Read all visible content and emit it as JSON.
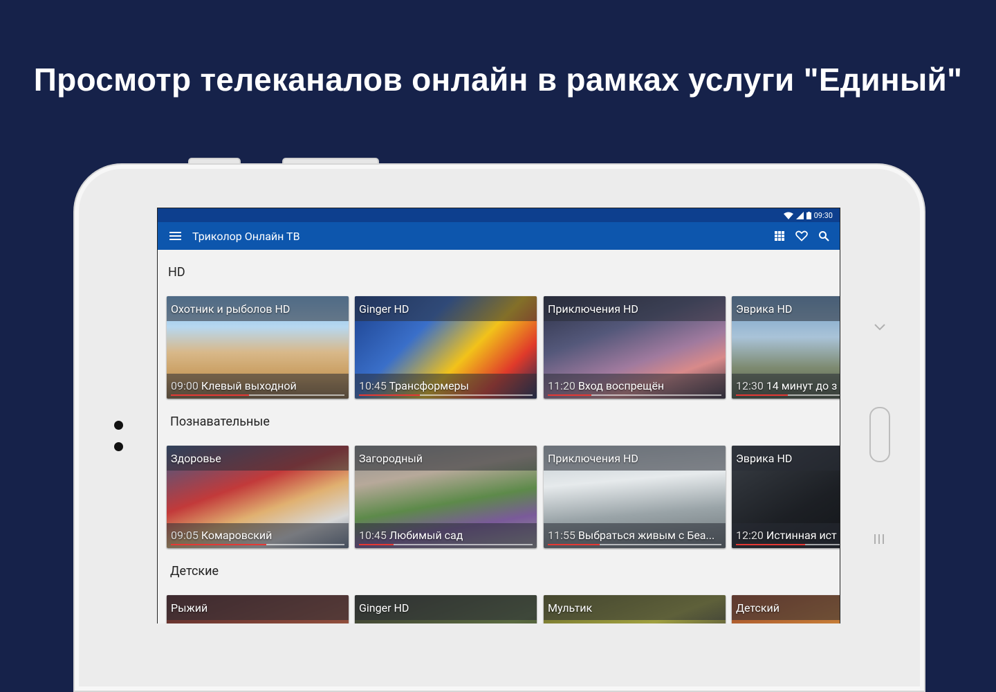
{
  "promo": {
    "title": "Просмотр телеканалов онлайн в рамках услуги \"Единый\""
  },
  "status_bar": {
    "time": "09:30"
  },
  "app_bar": {
    "title": "Триколор Онлайн ТВ",
    "icons": [
      "menu-icon",
      "grid-icon",
      "heart-icon",
      "search-icon"
    ]
  },
  "sections": [
    {
      "title": "HD",
      "cards": [
        {
          "channel": "Охотник и рыболов HD",
          "time": "09:00",
          "program": "Клевый выходной",
          "progress": 0.45
        },
        {
          "channel": "Ginger HD",
          "time": "10:45",
          "program": "Трансформеры",
          "progress": 0.35
        },
        {
          "channel": "Приключения HD",
          "time": "11:20",
          "program": "Вход воспрещён",
          "progress": 0.25
        },
        {
          "channel": "Эврика HD",
          "time": "12:30",
          "program": "14 минут до з",
          "progress": 0.3
        }
      ]
    },
    {
      "title": "Познавательные",
      "cards": [
        {
          "channel": "Здоровье",
          "time": "09:05",
          "program": "Комаровский",
          "progress": 0.55
        },
        {
          "channel": "Загородный",
          "time": "10:45",
          "program": "Любимый сад",
          "progress": 0.2
        },
        {
          "channel": "Приключения HD",
          "time": "11:55",
          "program": "Выбраться живым с Беа...",
          "progress": 0.3
        },
        {
          "channel": "Эврика HD",
          "time": "12:20",
          "program": "Истинная ист",
          "progress": 0.4
        }
      ]
    },
    {
      "title": "Детские",
      "cards": [
        {
          "channel": "Рыжий",
          "time": "",
          "program": "",
          "progress": 0
        },
        {
          "channel": "Ginger HD",
          "time": "",
          "program": "",
          "progress": 0
        },
        {
          "channel": "Мультик",
          "time": "",
          "program": "",
          "progress": 0
        },
        {
          "channel": "Детский",
          "time": "",
          "program": "",
          "progress": 0
        }
      ]
    }
  ]
}
